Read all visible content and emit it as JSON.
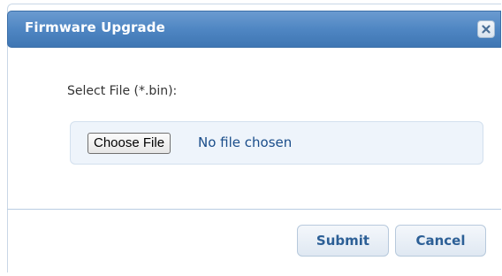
{
  "dialog": {
    "title": "Firmware Upgrade",
    "close_icon": "close-icon"
  },
  "form": {
    "select_label": "Select File (*.bin):",
    "choose_button": "Choose File",
    "file_status": "No file chosen"
  },
  "footer": {
    "submit_label": "Submit",
    "cancel_label": "Cancel"
  },
  "colors": {
    "titlebar": "#4f86c3",
    "button_text": "#2c5f96",
    "file_box_bg": "#eef4fb"
  }
}
